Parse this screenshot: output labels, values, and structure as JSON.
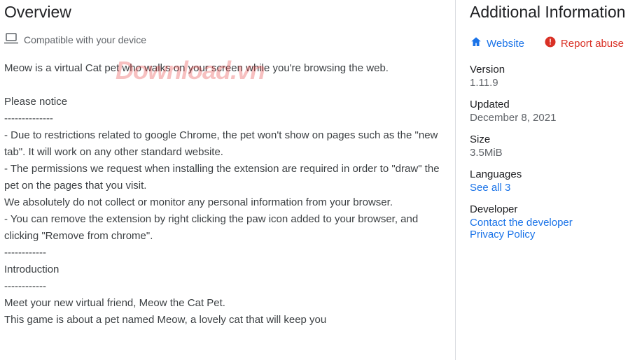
{
  "main": {
    "title": "Overview",
    "compat": "Compatible with your device",
    "description": "Meow is a virtual Cat pet who walks on your screen while you're browsing the web.\n\nPlease notice\n--------------\n- Due to restrictions related to google Chrome, the pet won't show on pages such as the \"new tab\". It will work on any other standard website.\n- The permissions we request when installing the extension are required in order to \"draw\" the pet on the pages that you visit.\nWe absolutely do not collect or monitor any personal information from your browser.\n- You can remove the extension by right clicking the paw icon added to your browser, and clicking \"Remove from chrome\".\n------------\nIntroduction\n------------\nMeet your new virtual friend, Meow the Cat Pet.\nThis game is about a pet named Meow, a lovely cat that will keep you"
  },
  "watermark": "Download.vn",
  "sidebar": {
    "title": "Additional Information",
    "website": "Website",
    "report": "Report abuse",
    "items": {
      "version": {
        "label": "Version",
        "value": "1.11.9"
      },
      "updated": {
        "label": "Updated",
        "value": "December 8, 2021"
      },
      "size": {
        "label": "Size",
        "value": "3.5MiB"
      },
      "languages": {
        "label": "Languages",
        "link": "See all 3"
      },
      "developer": {
        "label": "Developer",
        "contact": "Contact the developer",
        "privacy": "Privacy Policy"
      }
    }
  }
}
